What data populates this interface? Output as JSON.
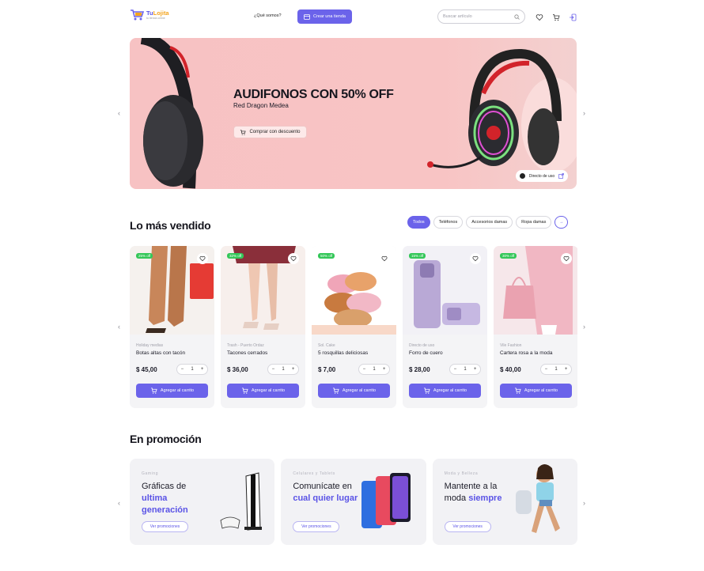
{
  "header": {
    "logo_brand_a": "Tu",
    "logo_brand_b": "Lojita",
    "logo_tagline": "tu tienda online",
    "about_link": "¿Qué somos?",
    "create_store_button": "Crear una tienda",
    "search_placeholder": "Buscar artículo"
  },
  "hero": {
    "title": "AUDIFONOS CON 50% OFF",
    "subtitle": "Red Dragon Medea",
    "cta": "Comprar con descuento",
    "direct_label": "Directo de uso"
  },
  "best_sellers": {
    "title": "Lo más vendido",
    "filters": [
      "Todos",
      "Teléfonos",
      "Accesorios damas",
      "Ropa damas"
    ],
    "products": [
      {
        "badge": "25% off",
        "store": "Holiday medias",
        "name": "Botas altas con tacón",
        "price": "$ 45,00",
        "qty": "1",
        "cta": "Agregar al carrito"
      },
      {
        "badge": "32% off",
        "store": "Trash - Puerto Ordaz",
        "name": "Tacones cerrados",
        "price": "$ 36,00",
        "qty": "1",
        "cta": "Agregar al carrito"
      },
      {
        "badge": "50% off",
        "store": "Sol. Cake",
        "name": "5 rosquillas deliciosas",
        "price": "$ 7,00",
        "qty": "1",
        "cta": "Agregar al carrito"
      },
      {
        "badge": "15% off",
        "store": "Directo de uso",
        "name": "Forro de cuero",
        "price": "$ 28,00",
        "qty": "1",
        "cta": "Agregar al carrito"
      },
      {
        "badge": "30% off",
        "store": "Vile Fashion",
        "name": "Cartera rosa a la moda",
        "price": "$ 40,00",
        "qty": "1",
        "cta": "Agregar al carrito"
      }
    ]
  },
  "promotions": {
    "title": "En promoción",
    "items": [
      {
        "category": "Gaming",
        "text": "Gráficas de",
        "highlight": "ultima generación",
        "cta": "Ver promociones"
      },
      {
        "category": "Celulares y Tablets",
        "text": "Comunícate en",
        "highlight": "cual quier lugar",
        "cta": "Ver promociones"
      },
      {
        "category": "Moda y Belleza",
        "text": "Mantente a la moda",
        "highlight": "siempre",
        "cta": "Ver promociones"
      }
    ]
  },
  "colors": {
    "accent": "#6b63ea",
    "badge_green": "#34c759",
    "hero_bg": "#f8c4c4",
    "card_bg": "#f4f4f6"
  },
  "icons": [
    "cart-logo-icon",
    "store-icon",
    "search-icon",
    "heart-icon",
    "cart-icon",
    "login-icon",
    "chevron-left-icon",
    "chevron-right-icon",
    "arrow-right-icon",
    "external-link-icon",
    "minus-icon",
    "plus-icon"
  ]
}
